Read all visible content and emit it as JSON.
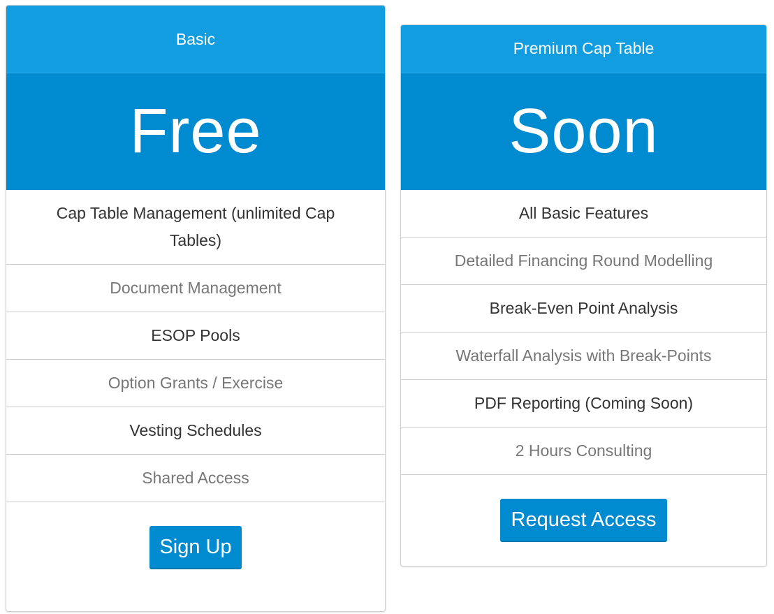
{
  "colors": {
    "header_blue": "#129de0",
    "price_blue": "#008bd0",
    "button_blue": "#008bd0",
    "text_dark": "#333333",
    "text_light": "#777777"
  },
  "plans": [
    {
      "name": "Basic",
      "price": "Free",
      "features": [
        "Cap Table Management (unlimited Cap Tables)",
        "Document Management",
        "ESOP Pools",
        "Option Grants / Exercise",
        "Vesting Schedules",
        "Shared Access"
      ],
      "button_label": "Sign Up"
    },
    {
      "name": "Premium Cap Table",
      "price": "Soon",
      "features": [
        "All Basic Features",
        "Detailed Financing Round Modelling",
        "Break-Even Point Analysis",
        "Waterfall Analysis with Break-Points",
        "PDF Reporting (Coming Soon)",
        "2 Hours Consulting"
      ],
      "button_label": "Request Access"
    }
  ]
}
